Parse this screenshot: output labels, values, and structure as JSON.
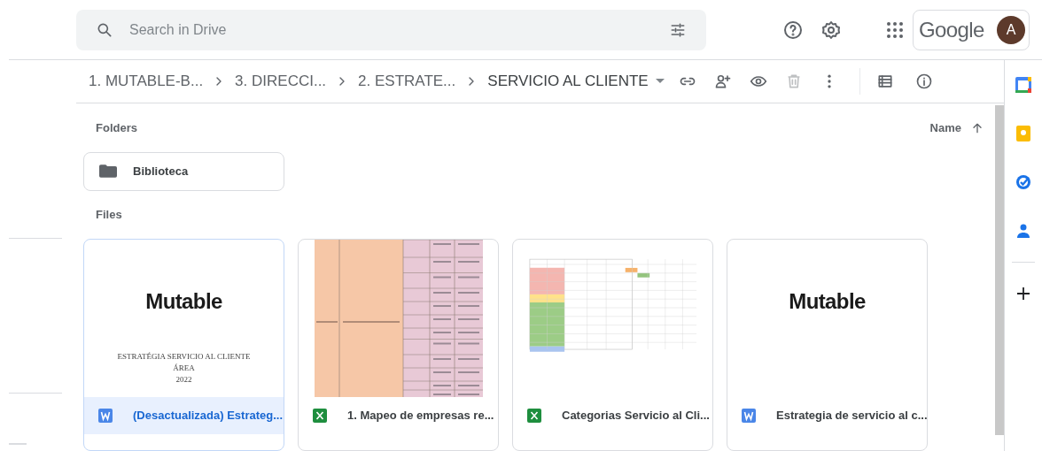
{
  "search": {
    "placeholder": "Search in Drive"
  },
  "account": {
    "brand": "Google",
    "avatar_letter": "A"
  },
  "breadcrumbs": [
    {
      "label": "1. MUTABLE-B..."
    },
    {
      "label": "3. DIRECCI..."
    },
    {
      "label": "2. ESTRATE..."
    },
    {
      "label": "SERVICIO AL CLIENTE"
    }
  ],
  "sort": {
    "label": "Name"
  },
  "folders_heading": "Folders",
  "folders": [
    {
      "name": "Biblioteca"
    }
  ],
  "files_heading": "Files",
  "files": [
    {
      "name": "(Desactualizada) Estrateg...",
      "kind": "doc",
      "selected": true,
      "preview": {
        "kind": "logo_doc",
        "logo": "Mutable",
        "lines": [
          "ESTRATÉGIA SERVICIO AL CLIENTE",
          "ÁREA",
          "2022"
        ]
      }
    },
    {
      "name": "1. Mapeo de empresas re...",
      "kind": "sheet",
      "selected": false,
      "preview": {
        "kind": "sheet_peach"
      }
    },
    {
      "name": "Categorias Servicio al Cli...",
      "kind": "sheet",
      "selected": false,
      "preview": {
        "kind": "sheet_color"
      }
    },
    {
      "name": "Estrategia de servicio al c...",
      "kind": "doc",
      "selected": false,
      "preview": {
        "kind": "logo_doc",
        "logo": "Mutable"
      }
    }
  ]
}
